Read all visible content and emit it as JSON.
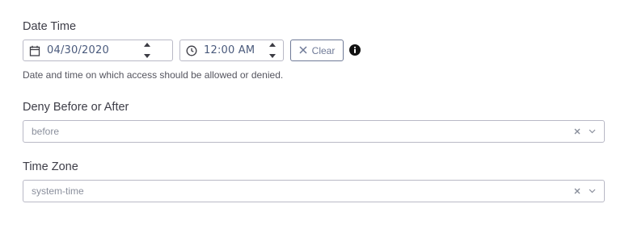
{
  "date_time": {
    "label": "Date Time",
    "date_value": "04/30/2020",
    "time_value": "12:00 AM",
    "clear_label": "Clear",
    "help_text": "Date and time on which access should be allowed or denied.",
    "date_icon": "calendar-icon",
    "time_icon": "clock-icon",
    "info_icon": "info-icon"
  },
  "deny_before_after": {
    "label": "Deny Before or After",
    "value": "before"
  },
  "time_zone": {
    "label": "Time Zone",
    "value": "system-time"
  },
  "colors": {
    "border": "#b9b9c6",
    "value_text": "#4a5a7c",
    "button_outline": "#6f7a97",
    "label_text": "#3d3d47"
  }
}
